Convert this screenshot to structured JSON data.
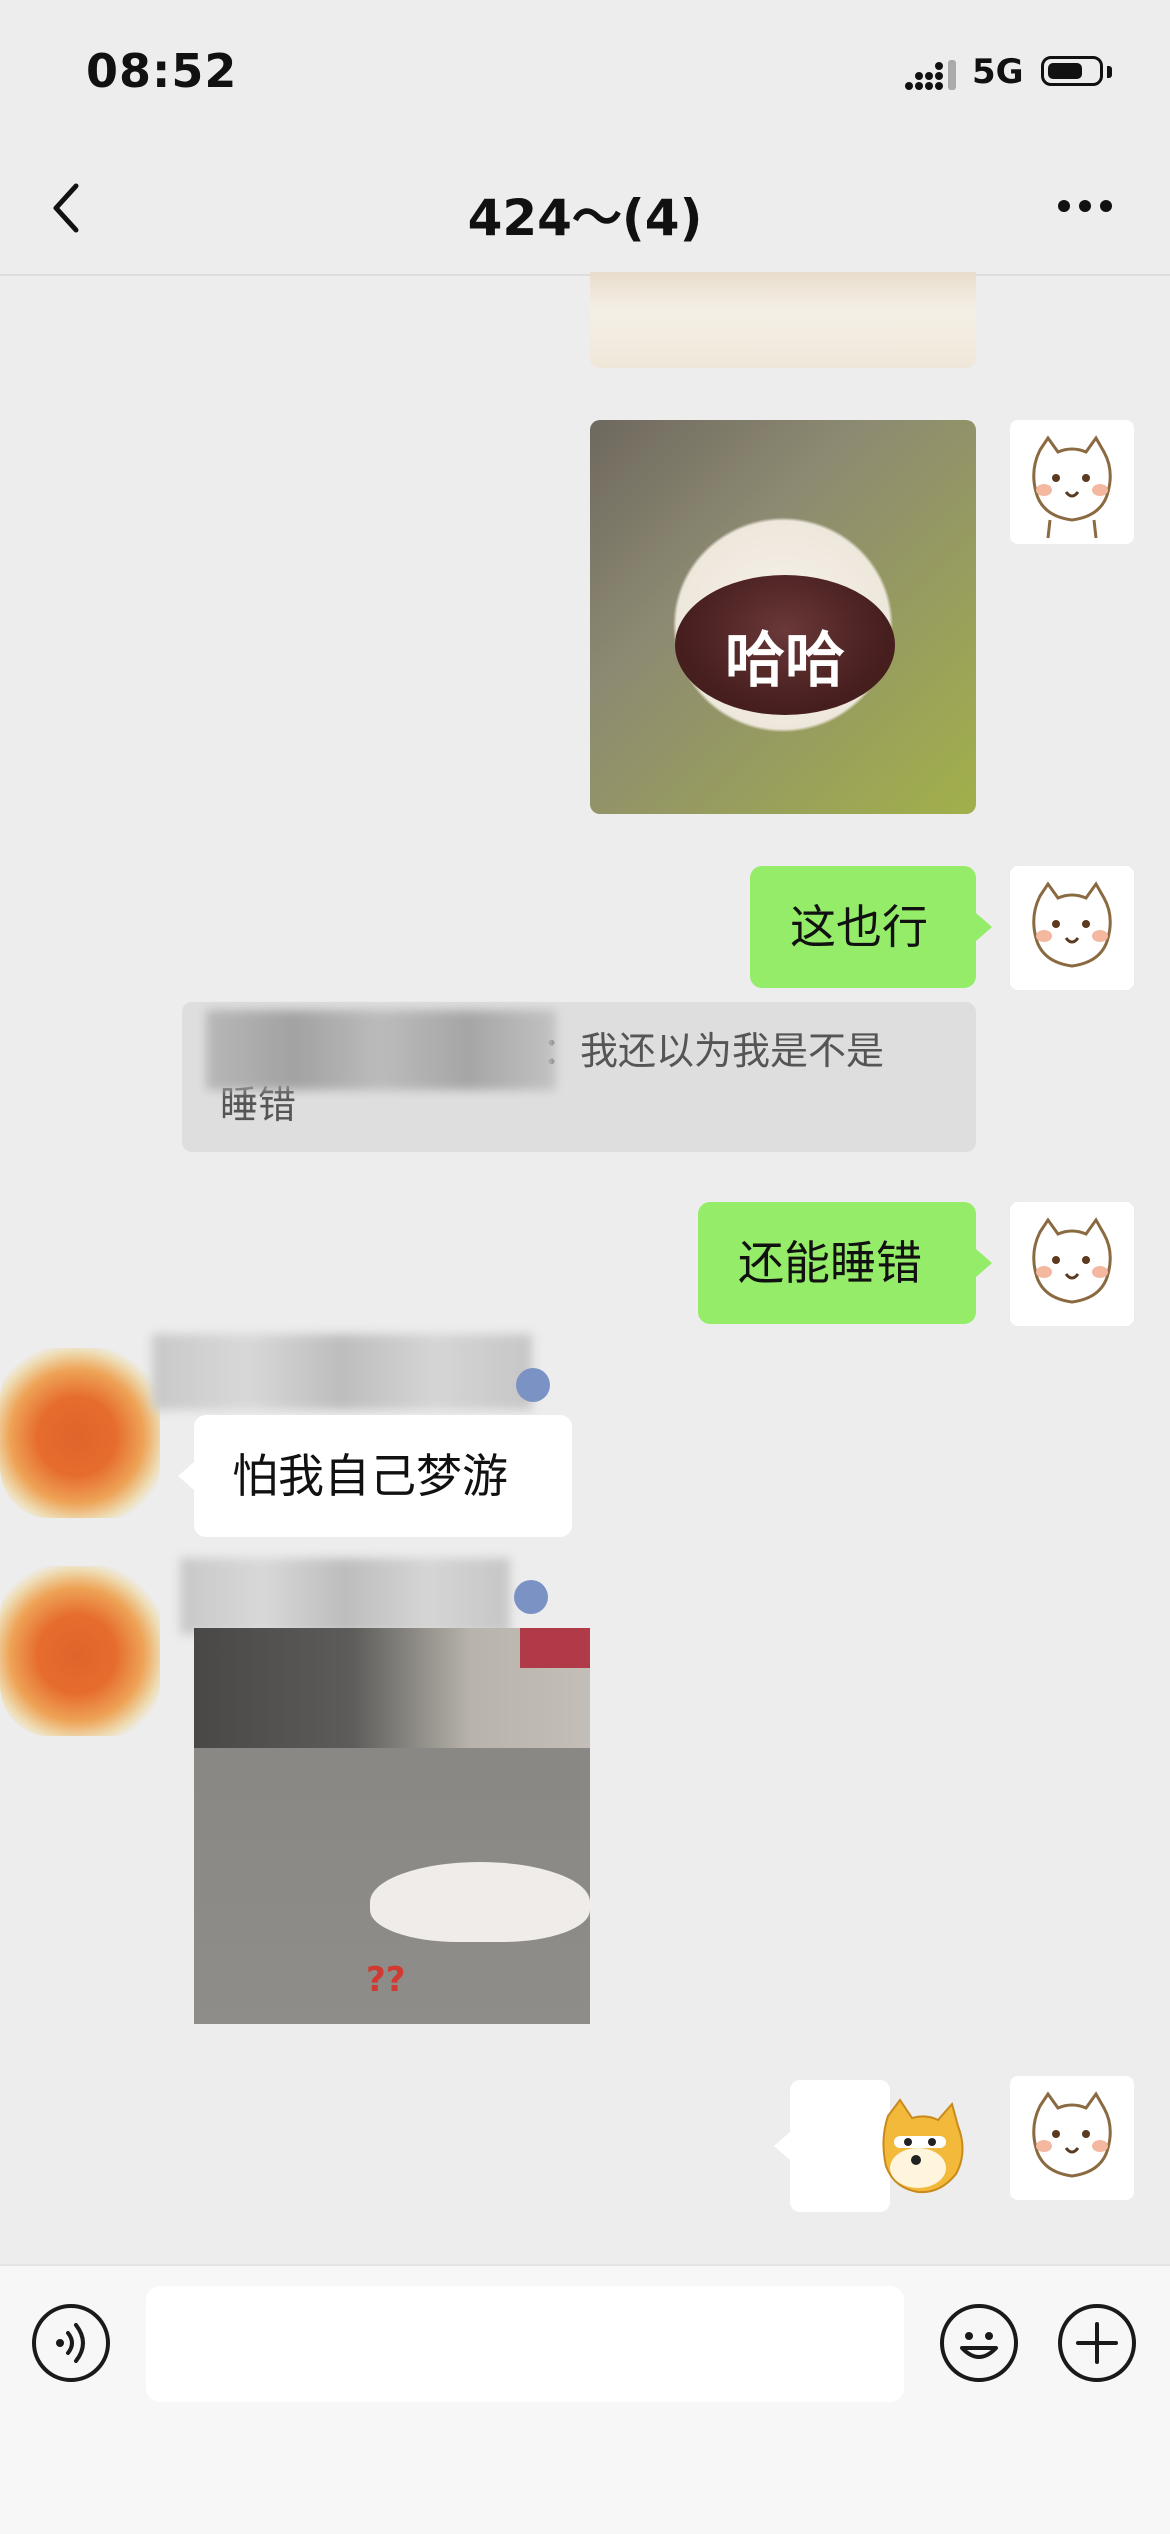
{
  "status_bar": {
    "time": "08:52",
    "network": "5G",
    "battery_level": 0.7
  },
  "nav": {
    "title": "424～(4)",
    "back_icon": "chevron-left-icon",
    "more_icon": "more-dots-icon"
  },
  "messages": [
    {
      "type": "image",
      "sender": "me",
      "description_icon": "cat-sticker"
    },
    {
      "type": "image",
      "sender": "me",
      "sticker_text": "哈哈"
    },
    {
      "type": "text",
      "sender": "me",
      "text": "这也行"
    },
    {
      "type": "quote",
      "text_line1": "：我还以为我是不是",
      "text_line2": "睡错"
    },
    {
      "type": "text",
      "sender": "me",
      "text": "还能睡错"
    },
    {
      "type": "text",
      "sender": "other",
      "text": "怕我自己梦游"
    },
    {
      "type": "image",
      "sender": "other",
      "sticker_text": "??"
    },
    {
      "type": "sticker",
      "sender": "me"
    }
  ],
  "input": {
    "placeholder": "",
    "value": ""
  },
  "icons": {
    "voice": "voice-icon",
    "emoji": "emoji-icon",
    "plus": "plus-icon"
  },
  "colors": {
    "bubble_me": "#95ec69",
    "bubble_other": "#ffffff",
    "background": "#ededed"
  }
}
